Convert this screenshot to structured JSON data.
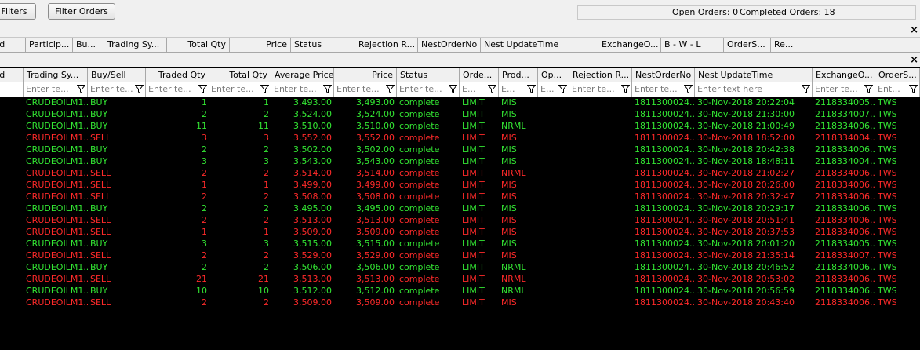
{
  "toolbar": {
    "filters_label": "Filters",
    "filter_orders_label": "Filter Orders",
    "open_orders": "Open Orders: 0",
    "completed_orders": "Completed Orders: 18"
  },
  "top_table": {
    "close_glyph": "×",
    "headers": [
      "Id",
      "Particip...",
      "Bu...",
      "Trading Sy...",
      "Total Qty",
      "Price",
      "Status",
      "Rejection R...",
      "NestOrderNo",
      "Nest UpdateTime",
      "ExchangeO...",
      "B - W - L",
      "OrderS...",
      "Re..."
    ]
  },
  "main_table": {
    "close_glyph": "×",
    "headers": [
      "Id",
      "Trading Sy...",
      "Buy/Sell",
      "Traded Qty",
      "Total Qty",
      "Average Price",
      "Price",
      "Status",
      "Orde...",
      "Prod...",
      "Op...",
      "Rejection R...",
      "NestOrderNo",
      "Nest UpdateTime",
      "ExchangeO...",
      "OrderS..."
    ],
    "filter_placeholders": [
      "",
      "Enter te...",
      "Enter te...",
      "Enter te...",
      "Enter te...",
      "Enter te...",
      "Enter te...",
      "Enter te...",
      "E...",
      "E...",
      "E...",
      "Enter te...",
      "Enter te...",
      "Enter text here",
      "Enter te...",
      "Ent..."
    ],
    "rows": [
      {
        "symbol": "CRUDEOILM1...",
        "side": "BUY",
        "traded": "1",
        "total": "1",
        "avg": "3,493.00",
        "price": "3,493.00",
        "status": "complete",
        "otype": "LIMIT",
        "prod": "MIS",
        "nest": "1811300024...",
        "time": "30-Nov-2018 20:22:04",
        "exch": "2118334005...",
        "src": "TWS"
      },
      {
        "symbol": "CRUDEOILM1...",
        "side": "BUY",
        "traded": "2",
        "total": "2",
        "avg": "3,524.00",
        "price": "3,524.00",
        "status": "complete",
        "otype": "LIMIT",
        "prod": "MIS",
        "nest": "1811300024...",
        "time": "30-Nov-2018 21:30:00",
        "exch": "2118334007...",
        "src": "TWS"
      },
      {
        "symbol": "CRUDEOILM1...",
        "side": "BUY",
        "traded": "11",
        "total": "11",
        "avg": "3,510.00",
        "price": "3,510.00",
        "status": "complete",
        "otype": "LIMIT",
        "prod": "NRML",
        "nest": "1811300024...",
        "time": "30-Nov-2018 21:00:49",
        "exch": "2118334006...",
        "src": "TWS"
      },
      {
        "symbol": "CRUDEOILM1...",
        "side": "SELL",
        "traded": "3",
        "total": "3",
        "avg": "3,552.00",
        "price": "3,552.00",
        "status": "complete",
        "otype": "LIMIT",
        "prod": "MIS",
        "nest": "1811300024...",
        "time": "30-Nov-2018 18:52:00",
        "exch": "2118334004...",
        "src": "TWS"
      },
      {
        "symbol": "CRUDEOILM1...",
        "side": "BUY",
        "traded": "2",
        "total": "2",
        "avg": "3,502.00",
        "price": "3,502.00",
        "status": "complete",
        "otype": "LIMIT",
        "prod": "MIS",
        "nest": "1811300024...",
        "time": "30-Nov-2018 20:42:38",
        "exch": "2118334006...",
        "src": "TWS"
      },
      {
        "symbol": "CRUDEOILM1...",
        "side": "BUY",
        "traded": "3",
        "total": "3",
        "avg": "3,543.00",
        "price": "3,543.00",
        "status": "complete",
        "otype": "LIMIT",
        "prod": "MIS",
        "nest": "1811300024...",
        "time": "30-Nov-2018 18:48:11",
        "exch": "2118334004...",
        "src": "TWS"
      },
      {
        "symbol": "CRUDEOILM1...",
        "side": "SELL",
        "traded": "2",
        "total": "2",
        "avg": "3,514.00",
        "price": "3,514.00",
        "status": "complete",
        "otype": "LIMIT",
        "prod": "NRML",
        "nest": "1811300024...",
        "time": "30-Nov-2018 21:02:27",
        "exch": "2118334006...",
        "src": "TWS"
      },
      {
        "symbol": "CRUDEOILM1...",
        "side": "SELL",
        "traded": "1",
        "total": "1",
        "avg": "3,499.00",
        "price": "3,499.00",
        "status": "complete",
        "otype": "LIMIT",
        "prod": "MIS",
        "nest": "1811300024...",
        "time": "30-Nov-2018 20:26:00",
        "exch": "2118334006...",
        "src": "TWS"
      },
      {
        "symbol": "CRUDEOILM1...",
        "side": "SELL",
        "traded": "2",
        "total": "2",
        "avg": "3,508.00",
        "price": "3,508.00",
        "status": "complete",
        "otype": "LIMIT",
        "prod": "MIS",
        "nest": "1811300024...",
        "time": "30-Nov-2018 20:32:47",
        "exch": "2118334006...",
        "src": "TWS"
      },
      {
        "symbol": "CRUDEOILM1...",
        "side": "BUY",
        "traded": "2",
        "total": "2",
        "avg": "3,495.00",
        "price": "3,495.00",
        "status": "complete",
        "otype": "LIMIT",
        "prod": "MIS",
        "nest": "1811300024...",
        "time": "30-Nov-2018 20:29:17",
        "exch": "2118334006...",
        "src": "TWS"
      },
      {
        "symbol": "CRUDEOILM1...",
        "side": "SELL",
        "traded": "2",
        "total": "2",
        "avg": "3,513.00",
        "price": "3,513.00",
        "status": "complete",
        "otype": "LIMIT",
        "prod": "MIS",
        "nest": "1811300024...",
        "time": "30-Nov-2018 20:51:41",
        "exch": "2118334006...",
        "src": "TWS"
      },
      {
        "symbol": "CRUDEOILM1...",
        "side": "SELL",
        "traded": "1",
        "total": "1",
        "avg": "3,509.00",
        "price": "3,509.00",
        "status": "complete",
        "otype": "LIMIT",
        "prod": "MIS",
        "nest": "1811300024...",
        "time": "30-Nov-2018 20:37:53",
        "exch": "2118334006...",
        "src": "TWS"
      },
      {
        "symbol": "CRUDEOILM1...",
        "side": "BUY",
        "traded": "3",
        "total": "3",
        "avg": "3,515.00",
        "price": "3,515.00",
        "status": "complete",
        "otype": "LIMIT",
        "prod": "MIS",
        "nest": "1811300024...",
        "time": "30-Nov-2018 20:01:20",
        "exch": "2118334005...",
        "src": "TWS"
      },
      {
        "symbol": "CRUDEOILM1...",
        "side": "SELL",
        "traded": "2",
        "total": "2",
        "avg": "3,529.00",
        "price": "3,529.00",
        "status": "complete",
        "otype": "LIMIT",
        "prod": "MIS",
        "nest": "1811300024...",
        "time": "30-Nov-2018 21:35:14",
        "exch": "2118334007...",
        "src": "TWS"
      },
      {
        "symbol": "CRUDEOILM1...",
        "side": "BUY",
        "traded": "2",
        "total": "2",
        "avg": "3,506.00",
        "price": "3,506.00",
        "status": "complete",
        "otype": "LIMIT",
        "prod": "NRML",
        "nest": "1811300024...",
        "time": "30-Nov-2018 20:46:52",
        "exch": "2118334006...",
        "src": "TWS"
      },
      {
        "symbol": "CRUDEOILM1...",
        "side": "SELL",
        "traded": "21",
        "total": "21",
        "avg": "3,513.00",
        "price": "3,513.00",
        "status": "complete",
        "otype": "LIMIT",
        "prod": "NRML",
        "nest": "1811300024...",
        "time": "30-Nov-2018 20:53:02",
        "exch": "2118334006...",
        "src": "TWS"
      },
      {
        "symbol": "CRUDEOILM1...",
        "side": "BUY",
        "traded": "10",
        "total": "10",
        "avg": "3,512.00",
        "price": "3,512.00",
        "status": "complete",
        "otype": "LIMIT",
        "prod": "NRML",
        "nest": "1811300024...",
        "time": "30-Nov-2018 20:56:59",
        "exch": "2118334006...",
        "src": "TWS"
      },
      {
        "symbol": "CRUDEOILM1...",
        "side": "SELL",
        "traded": "2",
        "total": "2",
        "avg": "3,509.00",
        "price": "3,509.00",
        "status": "complete",
        "otype": "LIMIT",
        "prod": "MIS",
        "nest": "1811300024...",
        "time": "30-Nov-2018 20:43:40",
        "exch": "2118334006...",
        "src": "TWS"
      }
    ]
  },
  "colors": {
    "buy": "#33e633",
    "sell": "#ff2a2a",
    "background": "#000000"
  },
  "icons": {
    "filter": "filter-funnel-icon",
    "close": "close-icon"
  }
}
